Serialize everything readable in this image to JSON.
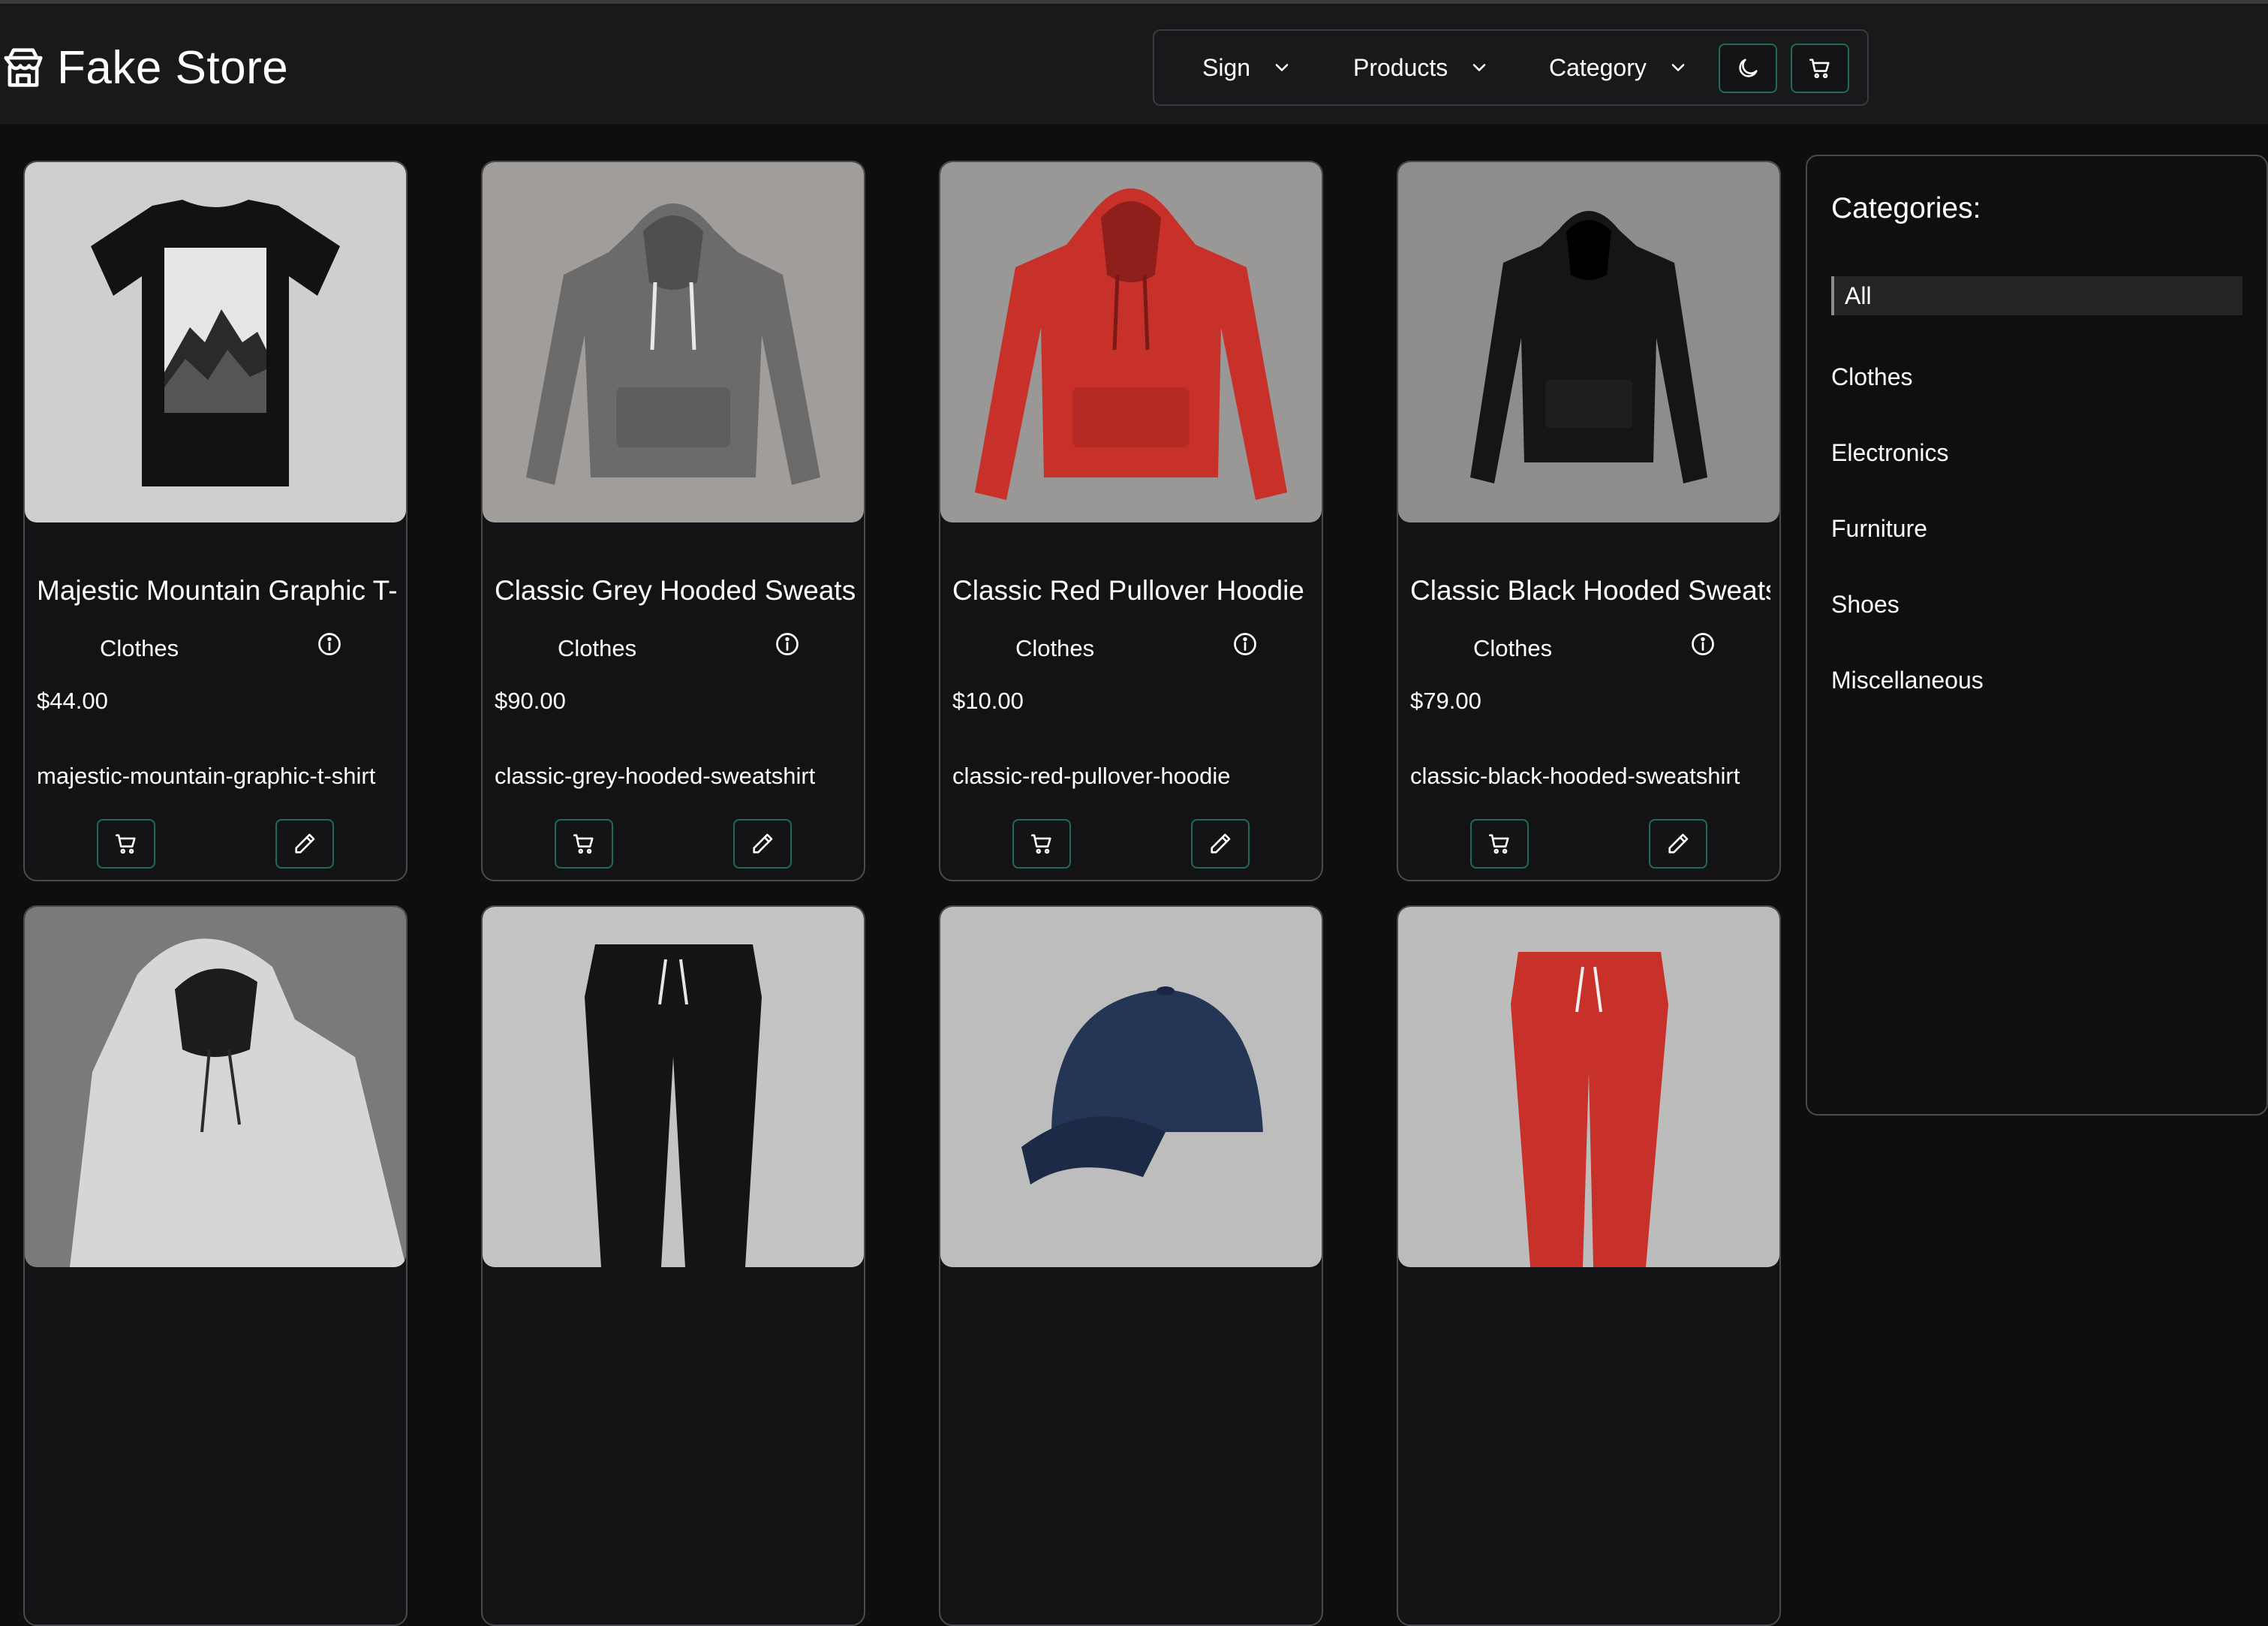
{
  "app": {
    "name": "Fake Store"
  },
  "nav": {
    "items": [
      {
        "label": "Sign"
      },
      {
        "label": "Products"
      },
      {
        "label": "Category"
      }
    ],
    "theme_icon": "moon-icon",
    "cart_icon": "cart-icon"
  },
  "products": [
    {
      "title": "Majestic Mountain Graphic T-Shirt",
      "category": "Clothes",
      "price": "$44.00",
      "slug": "majestic-mountain-graphic-t-shirt",
      "image": "black t-shirt with mountain graphic"
    },
    {
      "title": "Classic Grey Hooded Sweatshirt",
      "category": "Clothes",
      "price": "$90.00",
      "slug": "classic-grey-hooded-sweatshirt",
      "image": "grey hoodie"
    },
    {
      "title": "Classic Red Pullover Hoodie",
      "category": "Clothes",
      "price": "$10.00",
      "slug": "classic-red-pullover-hoodie",
      "image": "red hoodie"
    },
    {
      "title": "Classic Black Hooded Sweatshirt",
      "category": "Clothes",
      "price": "$79.00",
      "slug": "classic-black-hooded-sweatshirt",
      "image": "black hoodie"
    },
    {
      "image": "white hoodie"
    },
    {
      "image": "black joggers"
    },
    {
      "image": "navy baseball cap"
    },
    {
      "image": "red joggers"
    }
  ],
  "sidebar": {
    "title": "Categories:",
    "categories": [
      "All",
      "Clothes",
      "Electronics",
      "Furniture",
      "Shoes",
      "Miscellaneous"
    ],
    "selected": "All"
  },
  "colors": {
    "background": "#0e0e0f",
    "header": "#19191b",
    "accent_border": "#1f6b55",
    "card_border": "#4a4a4e"
  }
}
